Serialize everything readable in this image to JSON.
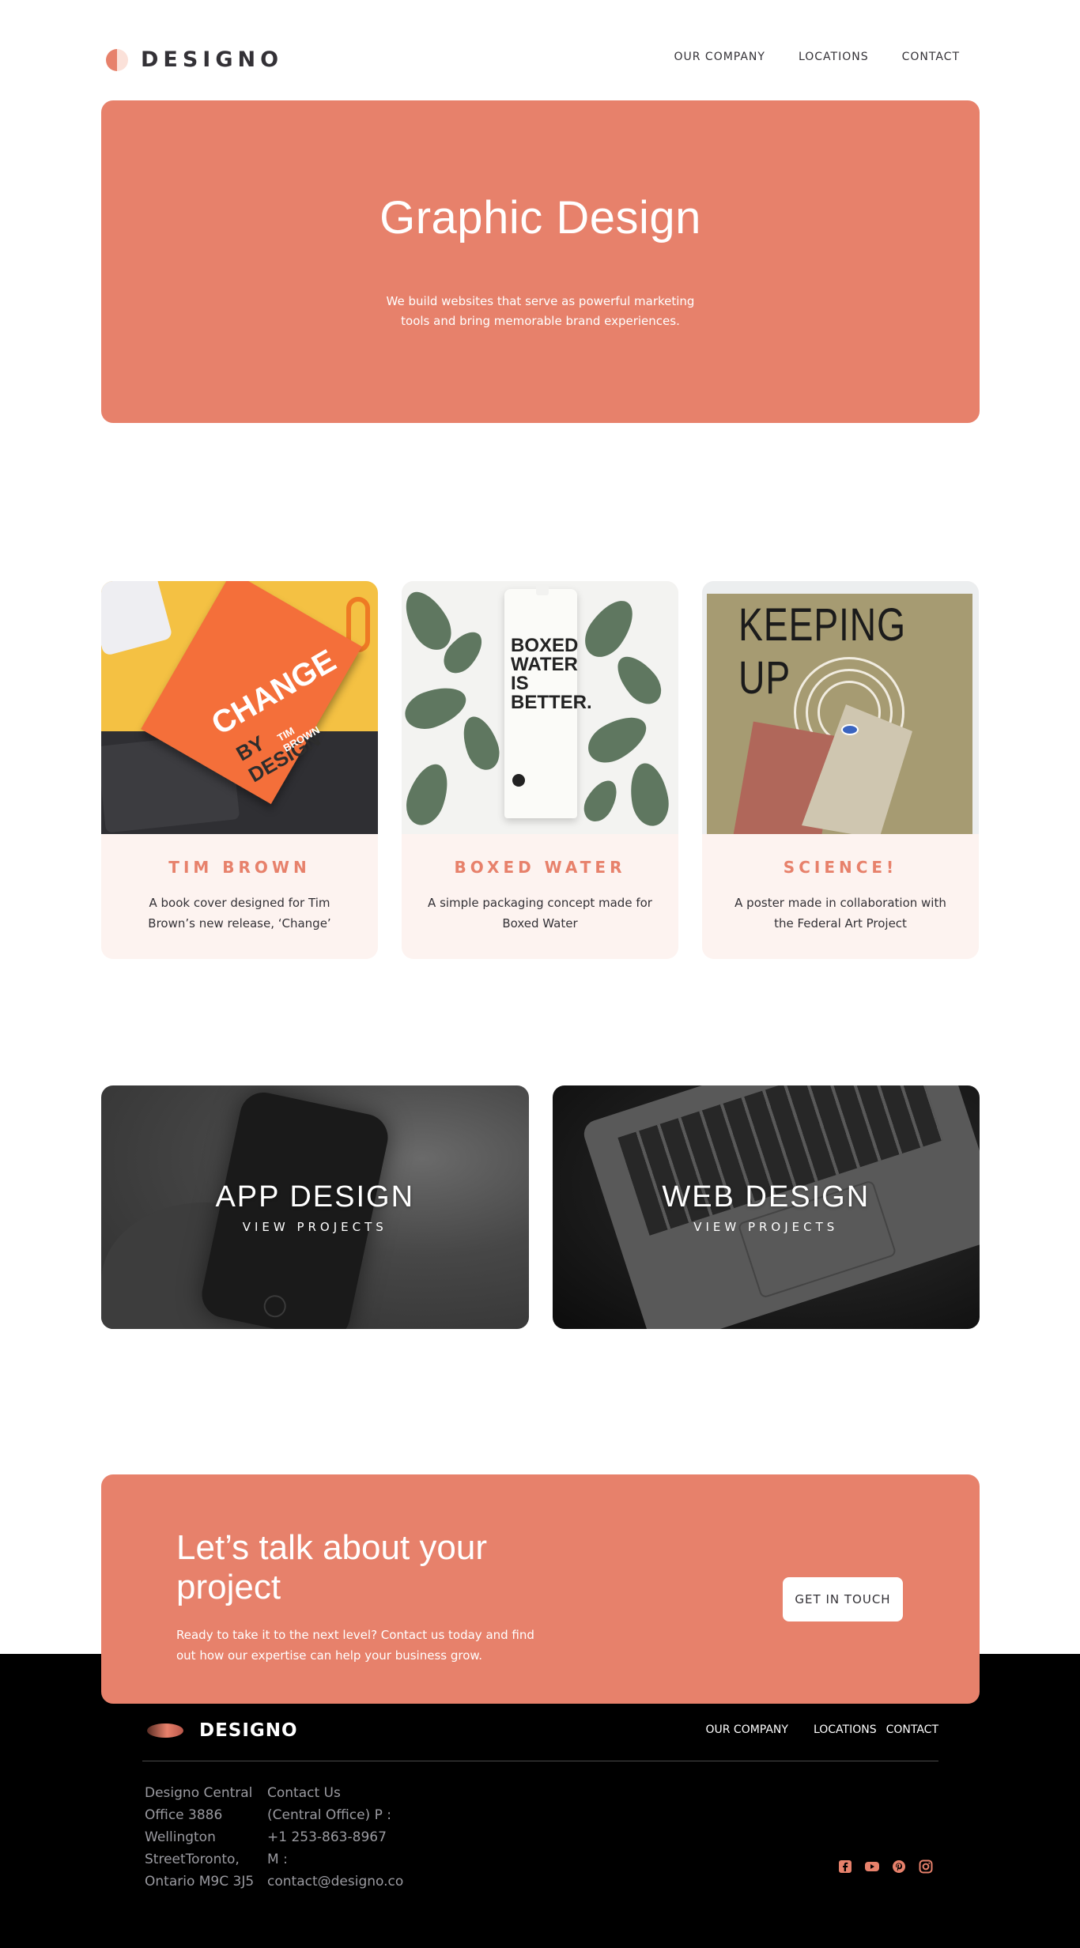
{
  "brand": {
    "name": "DESIGNO"
  },
  "nav": {
    "items": [
      "OUR COMPANY",
      "LOCATIONS",
      "CONTACT"
    ]
  },
  "hero": {
    "title": "Graphic Design",
    "description": "We build websites that serve as powerful marketing tools and bring memorable brand experiences."
  },
  "cards": [
    {
      "title": "TIM BROWN",
      "description": "A book cover designed for Tim Brown’s new release, ‘Change’",
      "image": "book-cover-photo"
    },
    {
      "title": "BOXED WATER",
      "description": "A simple packaging concept made for Boxed Water",
      "image": "boxed-water-carton-photo"
    },
    {
      "title": "SCIENCE!",
      "description": "A poster made in collaboration with the Federal Art Project",
      "image": "keeping-up-poster-photo"
    }
  ],
  "card_art": {
    "book_line1": "CHANGE",
    "book_line2": "BY DESIGN",
    "book_author": "TIM BROWN",
    "carton_text": "BOXED WATER IS BETTER.",
    "poster_heading": "KEEPING UP"
  },
  "projects": [
    {
      "title": "APP DESIGN",
      "link": "VIEW PROJECTS"
    },
    {
      "title": "WEB DESIGN",
      "link": "VIEW PROJECTS"
    }
  ],
  "cta": {
    "title": "Let’s talk about your project",
    "description": "Ready to take it to the next level? Contact us today and find out how our expertise can help your business grow.",
    "button": "GET IN TOUCH"
  },
  "footer": {
    "brand": "DESIGNO",
    "nav": [
      "OUR COMPANY",
      "LOCATIONS",
      "CONTACT"
    ],
    "address": "Designo Central Office 3886 Wellington StreetToronto, Ontario M9C 3J5",
    "contact": "Contact Us (Central Office) P : +1 253-863-8967 M : contact@designo.co",
    "social": [
      "facebook-icon",
      "youtube-icon",
      "pinterest-icon",
      "instagram-icon"
    ]
  },
  "colors": {
    "accent": "#e7816b",
    "card_bg": "#fdf3f0",
    "text_dark": "#333136",
    "footer_bg": "#000000"
  }
}
